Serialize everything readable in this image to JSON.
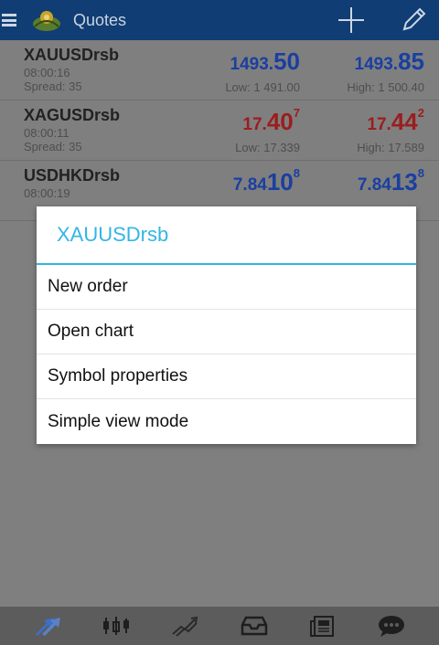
{
  "actionbar": {
    "title": "Quotes",
    "background": "#103d73"
  },
  "quotes": [
    {
      "symbol": "XAUUSDrsb",
      "time": "08:00:16",
      "spread": "Spread: 35",
      "bid": {
        "pre": "1493.",
        "big": "50",
        "sup": ""
      },
      "ask": {
        "pre": "1493.",
        "big": "85",
        "sup": ""
      },
      "low": "Low: 1 491.00",
      "high": "High: 1 500.40",
      "color": "#1a3fa0"
    },
    {
      "symbol": "XAGUSDrsb",
      "time": "08:00:11",
      "spread": "Spread: 35",
      "bid": {
        "pre": "17.",
        "big": "40",
        "sup": "7"
      },
      "ask": {
        "pre": "17.",
        "big": "44",
        "sup": "2"
      },
      "low": "Low: 17.339",
      "high": "High: 17.589",
      "color": "#9c1d1d"
    },
    {
      "symbol": "USDHKDrsb",
      "time": "08:00:19",
      "spread": "",
      "bid": {
        "pre": "7.84",
        "big": "10",
        "sup": "8"
      },
      "ask": {
        "pre": "7.84",
        "big": "13",
        "sup": "8"
      },
      "low": "",
      "high": "",
      "color": "#1a3fa0"
    }
  ],
  "dialog": {
    "title": "XAUUSDrsb",
    "accent": "#33b5e5",
    "items": [
      "New order",
      "Open chart",
      "Symbol properties",
      "Simple view mode"
    ]
  },
  "bottom_nav": [
    {
      "name": "quotes-nav-icon",
      "icon": "arrows-icon"
    },
    {
      "name": "chart-nav-icon",
      "icon": "candlestick-icon"
    },
    {
      "name": "trade-nav-icon",
      "icon": "trend-icon"
    },
    {
      "name": "history-nav-icon",
      "icon": "inbox-icon"
    },
    {
      "name": "news-nav-icon",
      "icon": "newspaper-icon"
    },
    {
      "name": "chat-nav-icon",
      "icon": "chat-bubble-icon"
    }
  ]
}
